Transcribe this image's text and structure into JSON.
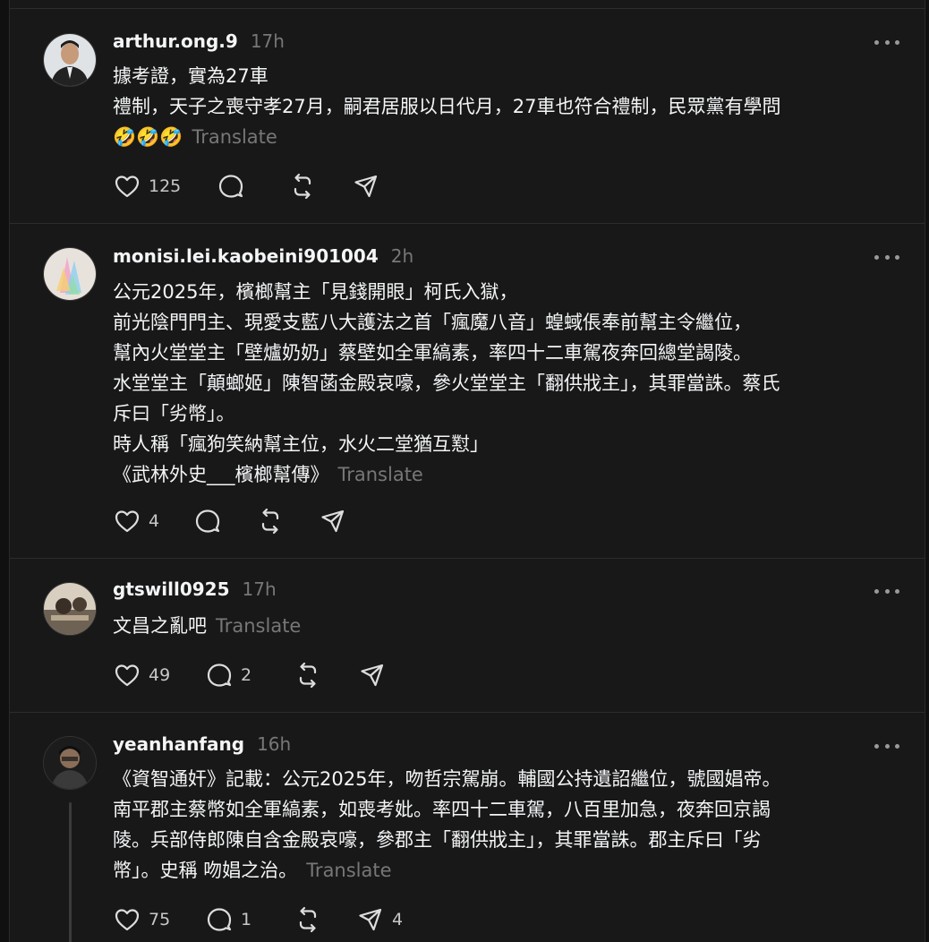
{
  "posts": [
    {
      "username": "arthur.ong.9",
      "time": "17h",
      "lines": [
        "據考證，實為27車",
        "禮制，天子之喪守孝27月，嗣君居服以日代月，27車也符合禮制，民眾黨有學問",
        "🤣🤣🤣"
      ],
      "translate": "Translate",
      "likes": "125",
      "replies": "",
      "reposts": "",
      "shares": ""
    },
    {
      "username": "monisi.lei.kaobeini901004",
      "time": "2h",
      "lines": [
        "公元2025年，檳榔幫主「見錢開眼」柯氏入獄，",
        "前光陰門門主、現愛支藍八大護法之首「瘋魔八音」蝗蜮倀奉前幫主令繼位，",
        "幫內火堂堂主「壁爐奶奶」蔡壁如全軍縞素，率四十二車駕夜奔回總堂謁陵。",
        "水堂堂主「顛螂姬」陳智菡金殿哀嚎，參火堂堂主「翻供戕主」，其罪當誅。蔡氏",
        "斥曰「劣幣」。",
        "時人稱「瘋狗笑納幫主位，水火二堂猶互懟」",
        "《武林外史___檳榔幫傳》"
      ],
      "translate": "Translate",
      "likes": "4",
      "replies": "",
      "reposts": "",
      "shares": ""
    },
    {
      "username": "gtswill0925",
      "time": "17h",
      "lines": [
        "文昌之亂吧"
      ],
      "translate": "Translate",
      "likes": "49",
      "replies": "2",
      "reposts": "",
      "shares": ""
    },
    {
      "username": "yeanhanfang",
      "time": "16h",
      "lines": [
        "《資智通奸》記載：公元2025年，吻哲宗駕崩。輔國公持遺詔繼位，號國娼帝。",
        "南平郡主蔡幣如全軍縞素，如喪考妣。率四十二車駕，八百里加急，夜奔回京謁",
        "陵。兵部侍郎陳自含金殿哀嚎，參郡主「翻供戕主」，其罪當誅。郡主斥曰「劣",
        "幣」。史稱 吻娼之治。"
      ],
      "translate": "Translate",
      "likes": "75",
      "replies": "1",
      "reposts": "",
      "shares": "4"
    }
  ],
  "colors": {
    "background": "#181818",
    "text": "#f3f5f7",
    "muted": "#777777"
  },
  "icons": [
    "heart-icon",
    "comment-icon",
    "repost-icon",
    "share-icon",
    "more-icon"
  ]
}
